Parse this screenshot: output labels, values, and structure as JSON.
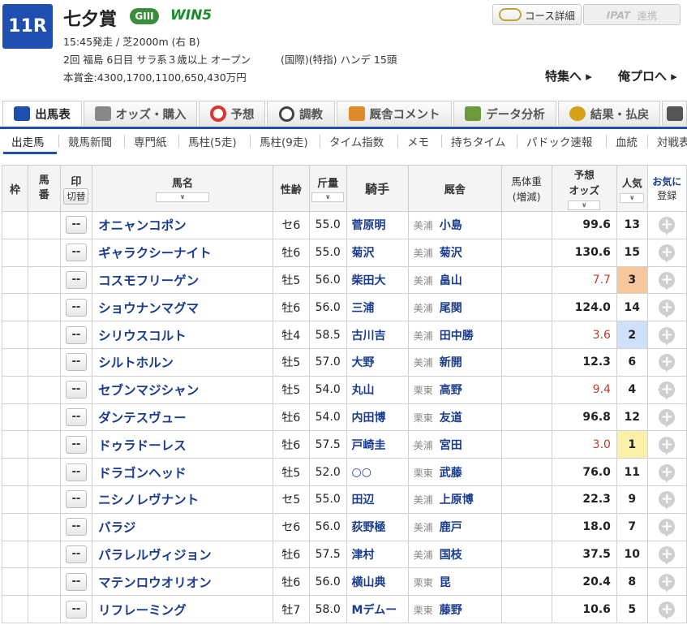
{
  "race": {
    "number": "11R",
    "name": "七夕賞",
    "grade": "GIII",
    "win5": "WIN5",
    "line1": "15:45発走 / 芝2000m (右 B)",
    "line2": "2回 福島 6日目 サラ系３歳以上 オープン 　 　 (国際)(特指) ハンデ 15頭",
    "line3": "本賞金:4300,1700,1100,650,430万円"
  },
  "top_buttons": {
    "course": "コース詳細",
    "ipat": "IPAT",
    "ipat_sub": "連携"
  },
  "top_links": {
    "special": "特集へ ▸",
    "oreport": "俺プロへ ▸"
  },
  "tabs": [
    {
      "label": "出馬表",
      "color": "#1e4fb0"
    },
    {
      "label": "オッズ・購入",
      "color": "#7a7a7a"
    },
    {
      "label": "予想",
      "color": "#d33"
    },
    {
      "label": "調教",
      "color": "#444"
    },
    {
      "label": "厩舎コメント",
      "color": "#e08a2a"
    },
    {
      "label": "データ分析",
      "color": "#6a9a3a"
    },
    {
      "label": "結果・払戻",
      "color": "#d4a017"
    }
  ],
  "subtabs": [
    "出走馬",
    "競馬新聞",
    "専門紙",
    "馬柱(5走)",
    "馬柱(9走)",
    "タイム指数",
    "メモ",
    "持ちタイム",
    "パドック速報",
    "血統",
    "対戦表"
  ],
  "headers": {
    "waku": "枠",
    "umaban": "馬番",
    "mark": "印",
    "mark_switch": "切替",
    "horse": "馬名",
    "sexage": "性齢",
    "weight": "斤量",
    "jockey": "騎手",
    "stable": "厩舎",
    "bodyweight": "馬体重",
    "bodyweight_sub": "(増減)",
    "odds": "予想",
    "odds_sub": "オッズ",
    "pop": "人気",
    "fav": "お気に",
    "fav_sub": "登録",
    "sort": "∨"
  },
  "rows": [
    {
      "mark": "--",
      "horse": "オニャンコポン",
      "sexage": "セ6",
      "weight": "55.0",
      "jockey": "菅原明",
      "region": "美浦",
      "trainer": "小島",
      "odds": "99.6",
      "pop": "13"
    },
    {
      "mark": "--",
      "horse": "ギャラクシーナイト",
      "sexage": "牡6",
      "weight": "55.0",
      "jockey": "菊沢",
      "region": "美浦",
      "trainer": "菊沢",
      "odds": "130.6",
      "pop": "15"
    },
    {
      "mark": "--",
      "horse": "コスモフリーゲン",
      "sexage": "牡5",
      "weight": "56.0",
      "jockey": "柴田大",
      "region": "美浦",
      "trainer": "畠山",
      "odds": "7.7",
      "pop": "3"
    },
    {
      "mark": "--",
      "horse": "ショウナンマグマ",
      "sexage": "牡6",
      "weight": "56.0",
      "jockey": "三浦",
      "region": "美浦",
      "trainer": "尾関",
      "odds": "124.0",
      "pop": "14"
    },
    {
      "mark": "--",
      "horse": "シリウスコルト",
      "sexage": "牡4",
      "weight": "58.5",
      "jockey": "古川吉",
      "region": "美浦",
      "trainer": "田中勝",
      "odds": "3.6",
      "pop": "2"
    },
    {
      "mark": "--",
      "horse": "シルトホルン",
      "sexage": "牡5",
      "weight": "57.0",
      "jockey": "大野",
      "region": "美浦",
      "trainer": "新開",
      "odds": "12.3",
      "pop": "6"
    },
    {
      "mark": "--",
      "horse": "セブンマジシャン",
      "sexage": "牡5",
      "weight": "54.0",
      "jockey": "丸山",
      "region": "栗東",
      "trainer": "高野",
      "odds": "9.4",
      "pop": "4"
    },
    {
      "mark": "--",
      "horse": "ダンテスヴュー",
      "sexage": "牡6",
      "weight": "54.0",
      "jockey": "内田博",
      "region": "栗東",
      "trainer": "友道",
      "odds": "96.8",
      "pop": "12"
    },
    {
      "mark": "--",
      "horse": "ドゥラドーレス",
      "sexage": "牡6",
      "weight": "57.5",
      "jockey": "戸崎圭",
      "region": "美浦",
      "trainer": "宮田",
      "odds": "3.0",
      "pop": "1"
    },
    {
      "mark": "--",
      "horse": "ドラゴンヘッド",
      "sexage": "牡5",
      "weight": "52.0",
      "jockey": "○○",
      "region": "栗東",
      "trainer": "武藤",
      "odds": "76.0",
      "pop": "11"
    },
    {
      "mark": "--",
      "horse": "ニシノレヴナント",
      "sexage": "セ5",
      "weight": "55.0",
      "jockey": "田辺",
      "region": "美浦",
      "trainer": "上原博",
      "odds": "22.3",
      "pop": "9"
    },
    {
      "mark": "--",
      "horse": "バラジ",
      "sexage": "セ6",
      "weight": "56.0",
      "jockey": "荻野極",
      "region": "美浦",
      "trainer": "鹿戸",
      "odds": "18.0",
      "pop": "7"
    },
    {
      "mark": "--",
      "horse": "パラレルヴィジョン",
      "sexage": "牡6",
      "weight": "57.5",
      "jockey": "津村",
      "region": "美浦",
      "trainer": "国枝",
      "odds": "37.5",
      "pop": "10"
    },
    {
      "mark": "--",
      "horse": "マテンロウオリオン",
      "sexage": "牡6",
      "weight": "56.0",
      "jockey": "横山典",
      "region": "栗東",
      "trainer": "昆",
      "odds": "20.4",
      "pop": "8"
    },
    {
      "mark": "--",
      "horse": "リフレーミング",
      "sexage": "牡7",
      "weight": "58.0",
      "jockey": "Mデムー",
      "region": "栗東",
      "trainer": "藤野",
      "odds": "10.6",
      "pop": "5"
    }
  ],
  "pop_colors": {
    "1": "#fcf0a8",
    "2": "#cfe0fb",
    "3": "#f6c79a"
  },
  "hot_odds_threshold": 10
}
